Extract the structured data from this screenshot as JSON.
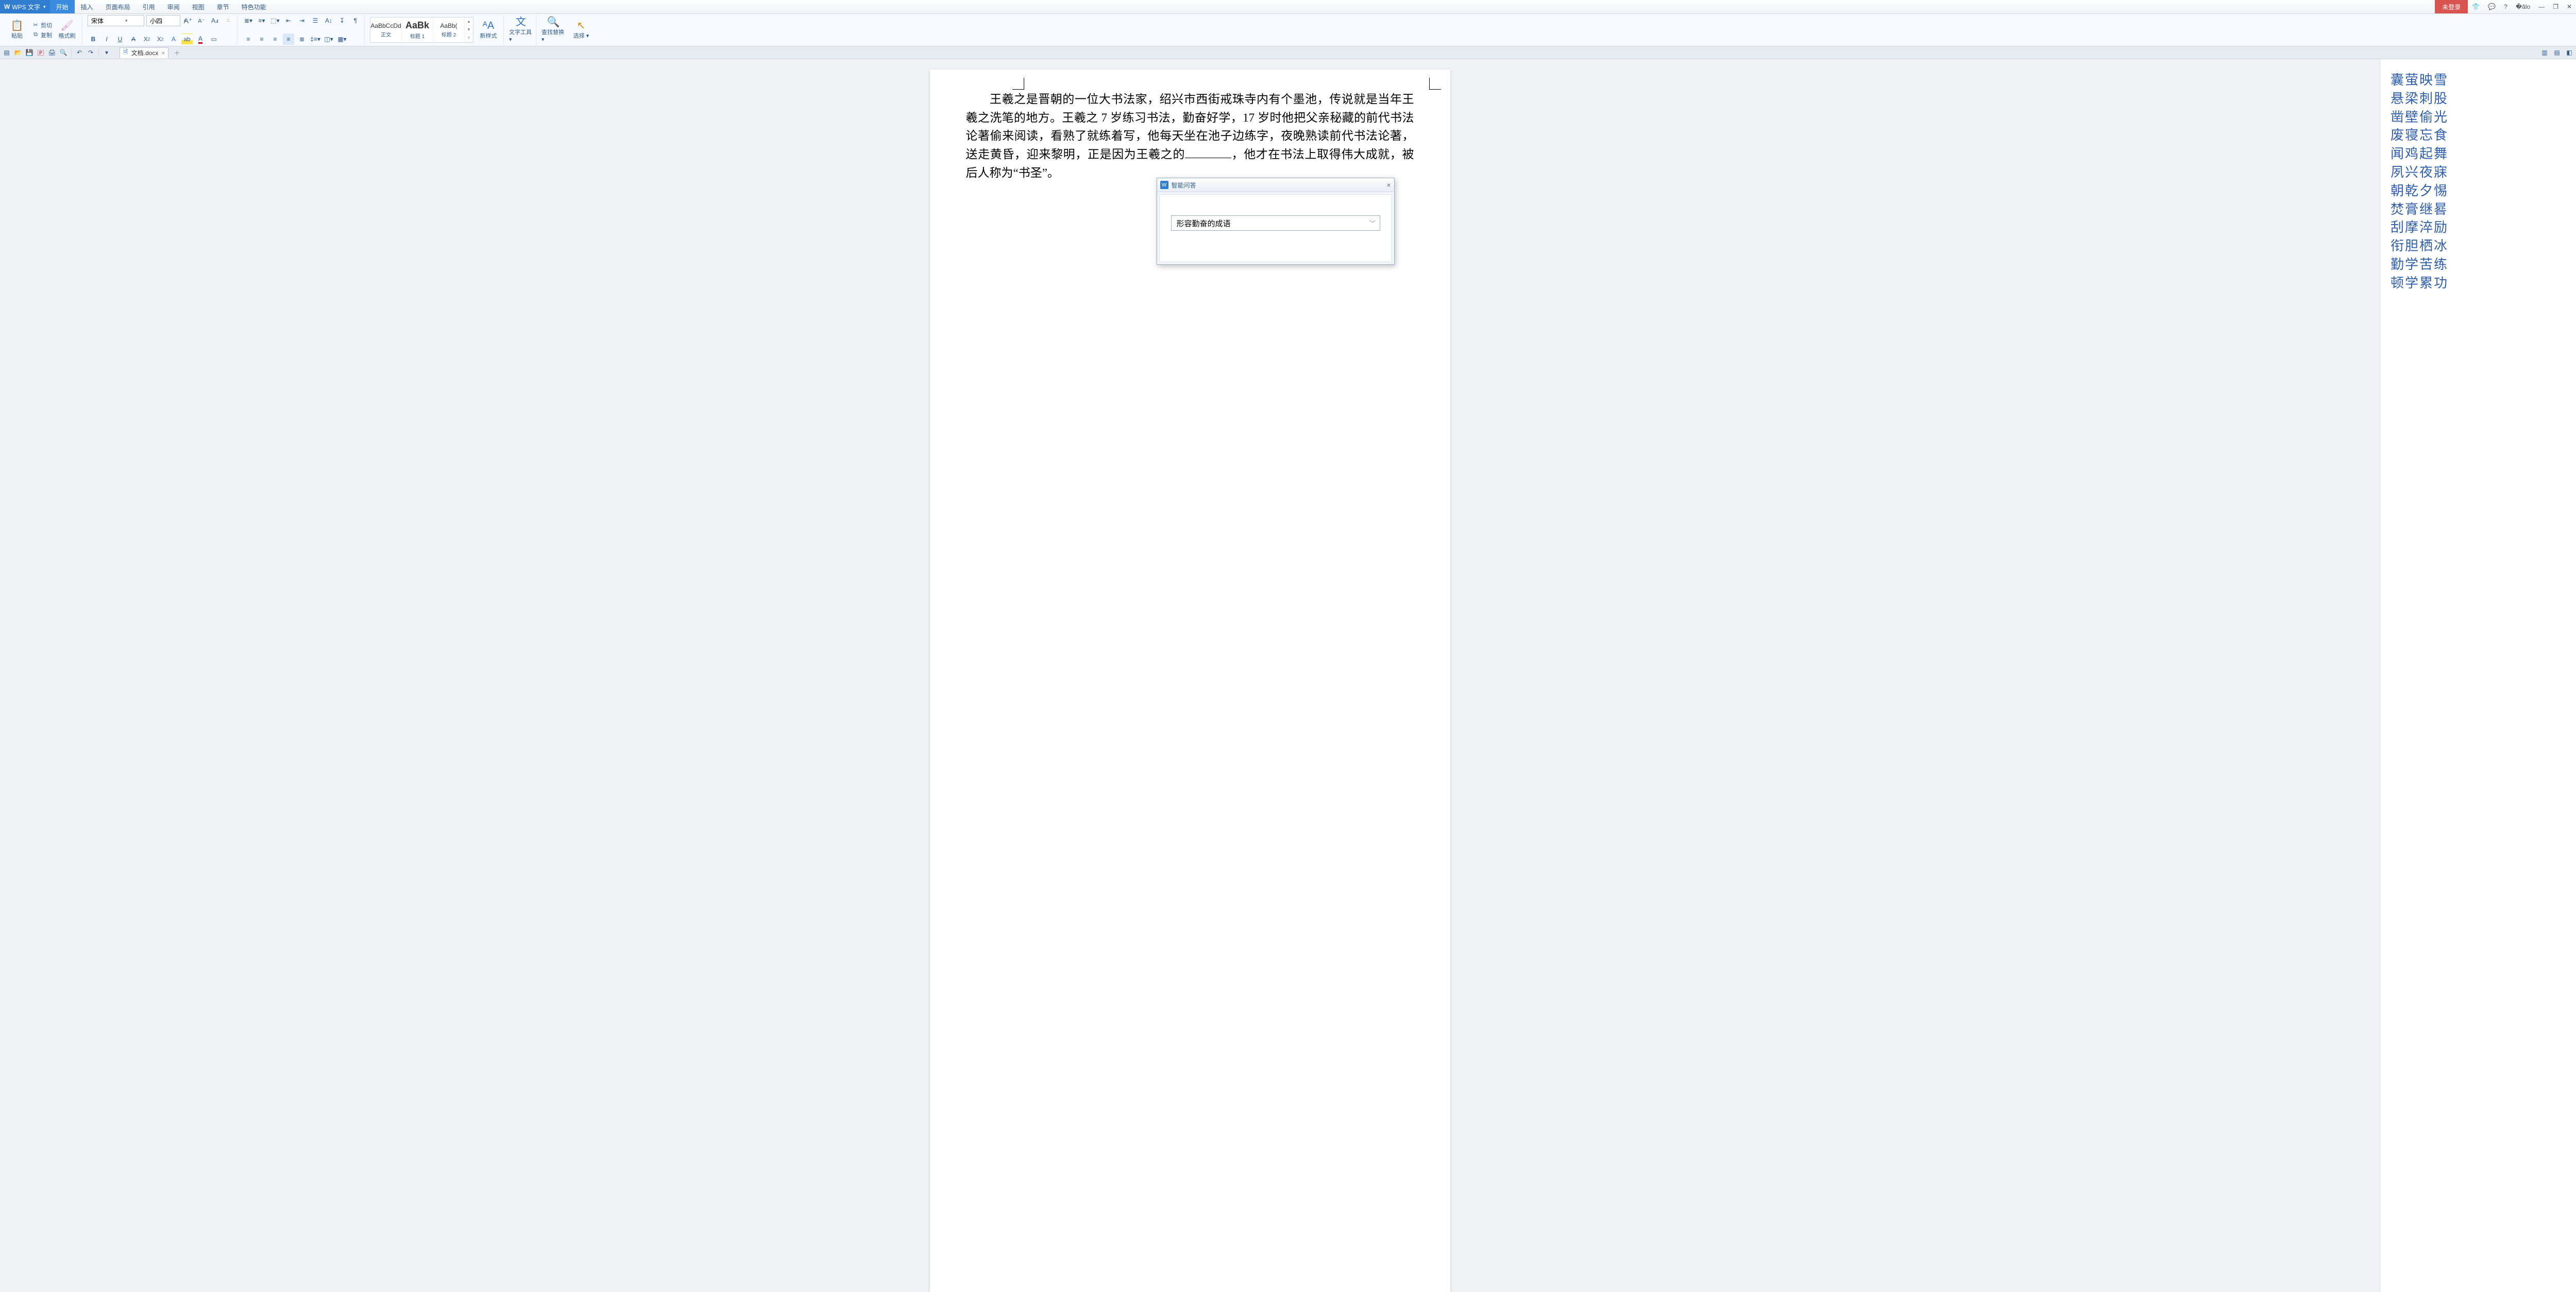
{
  "app": {
    "name": "WPS 文字",
    "login": "未登录"
  },
  "menu": {
    "items": [
      "开始",
      "插入",
      "页面布局",
      "引用",
      "审阅",
      "视图",
      "章节",
      "特色功能"
    ],
    "active": 0
  },
  "clipboard": {
    "paste": "粘贴",
    "cut": "剪切",
    "copy": "复制",
    "format_painter": "格式刷"
  },
  "font": {
    "family": "宋体",
    "size": "小四",
    "grow": "A",
    "shrink": "A",
    "clear": "A"
  },
  "toggles": {
    "bold": "B",
    "italic": "I",
    "underline": "U",
    "strike": "A",
    "super": "X²",
    "sub": "X₂",
    "phonetic": "A",
    "highlight": "aṇ",
    "color": "A",
    "border": "田"
  },
  "styles": {
    "gallery": [
      {
        "preview": "AaBbCcDd",
        "label": "正文"
      },
      {
        "preview": "AaBk",
        "label": "标题 1"
      },
      {
        "preview": "AaBb(",
        "label": "标题 2"
      }
    ],
    "new": "新样式"
  },
  "tools": {
    "text_tools": "文字工具",
    "find_replace": "查找替换",
    "select": "选择"
  },
  "doc_tab": {
    "name": "文档.docx"
  },
  "document": {
    "para1_a": "王羲之是晋朝的一位大书法家，绍兴市西街戒珠寺内有个墨池，传说就是当年王羲之洗笔的地方。王羲之 7 岁练习书法，勤奋好学，17 岁时他把父亲秘藏的前代书法论著偷来阅读，看熟了就练着写，他每天坐在池子边练字，夜晚熟读前代书法论著，送走黄昏，迎来黎明，正是因为王羲之的",
    "para1_b": "，他才在书法上取得伟大成就，被后人称为“书圣”。"
  },
  "dialog": {
    "title": "智能问答",
    "input": "形容勤奋的成语"
  },
  "idioms": [
    "囊萤映雪",
    "悬梁刺股",
    "凿壁偷光",
    "废寝忘食",
    "闻鸡起舞",
    "夙兴夜寐",
    "朝乾夕惕",
    "焚膏继晷",
    "刮摩淬励",
    "衔胆栖冰",
    "勤学苦练",
    "顿学累功"
  ]
}
